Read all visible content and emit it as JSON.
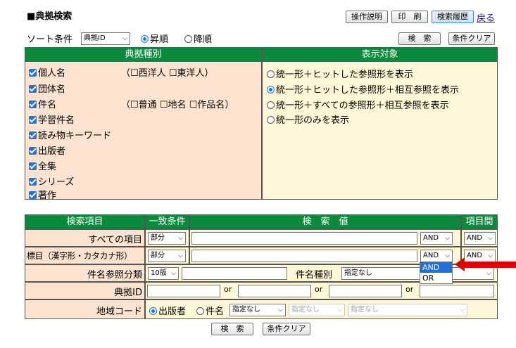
{
  "header": {
    "title": "■典拠検索",
    "buttons": [
      "操作説明",
      "印　刷",
      "検索履歴"
    ],
    "back_link": "戻る"
  },
  "sort": {
    "label": "ソート条件",
    "select_value": "典拠ID",
    "options": [
      "昇順",
      "降順"
    ],
    "selected": "昇順"
  },
  "top_actions": {
    "search": "検　索",
    "clear": "条件クリア"
  },
  "type_panel": {
    "header": "典拠種別",
    "items": [
      {
        "label": "個人名",
        "sub": [
          "西洋人",
          "東洋人"
        ]
      },
      {
        "label": "団体名"
      },
      {
        "label": "件名",
        "sub": [
          "普通",
          "地名",
          "作品名"
        ]
      },
      {
        "label": "学習件名"
      },
      {
        "label": "読み物キーワード"
      },
      {
        "label": "出版者"
      },
      {
        "label": "全集"
      },
      {
        "label": "シリーズ"
      },
      {
        "label": "著作"
      }
    ],
    "paren_open": "（",
    "paren_close": "）"
  },
  "display_panel": {
    "header": "表示対象",
    "options": [
      "統一形＋ヒットした参照形を表示",
      "統一形＋ヒットした参照形＋相互参照を表示",
      "統一形＋すべての参照形＋相互参照を表示",
      "統一形のみを表示"
    ],
    "selected_index": 1
  },
  "search_table": {
    "headers": [
      "検索項目",
      "一致条件",
      "検　索　値",
      "項目間"
    ],
    "rows": {
      "all_items": {
        "label": "すべての項目",
        "match": "部分",
        "op": "AND",
        "between": "AND"
      },
      "heading": {
        "label": "標目（漢字形・カタカナ形）",
        "match": "部分",
        "op": "AND",
        "between": "AND"
      },
      "subject_class": {
        "label": "件名参照分類",
        "select": "10版",
        "type_label": "件名種別",
        "type_value": "指定なし"
      },
      "authority_id": {
        "label": "典拠ID",
        "or": "or"
      },
      "region": {
        "label": "地域コード",
        "radio_options": [
          "出版者",
          "件名"
        ],
        "selected": "出版者",
        "selects": [
          "指定なし",
          "指定なし",
          "指定なし"
        ]
      }
    },
    "dropdown_options": [
      "AND",
      "OR"
    ],
    "dropdown_highlight": "AND"
  },
  "bottom_actions": {
    "search": "検　索",
    "clear": "条件クリア"
  },
  "colors": {
    "green": "#0a8a3c",
    "peach": "#fbe3d0",
    "yellow": "#fff7d6",
    "arrow": "#e00000"
  }
}
